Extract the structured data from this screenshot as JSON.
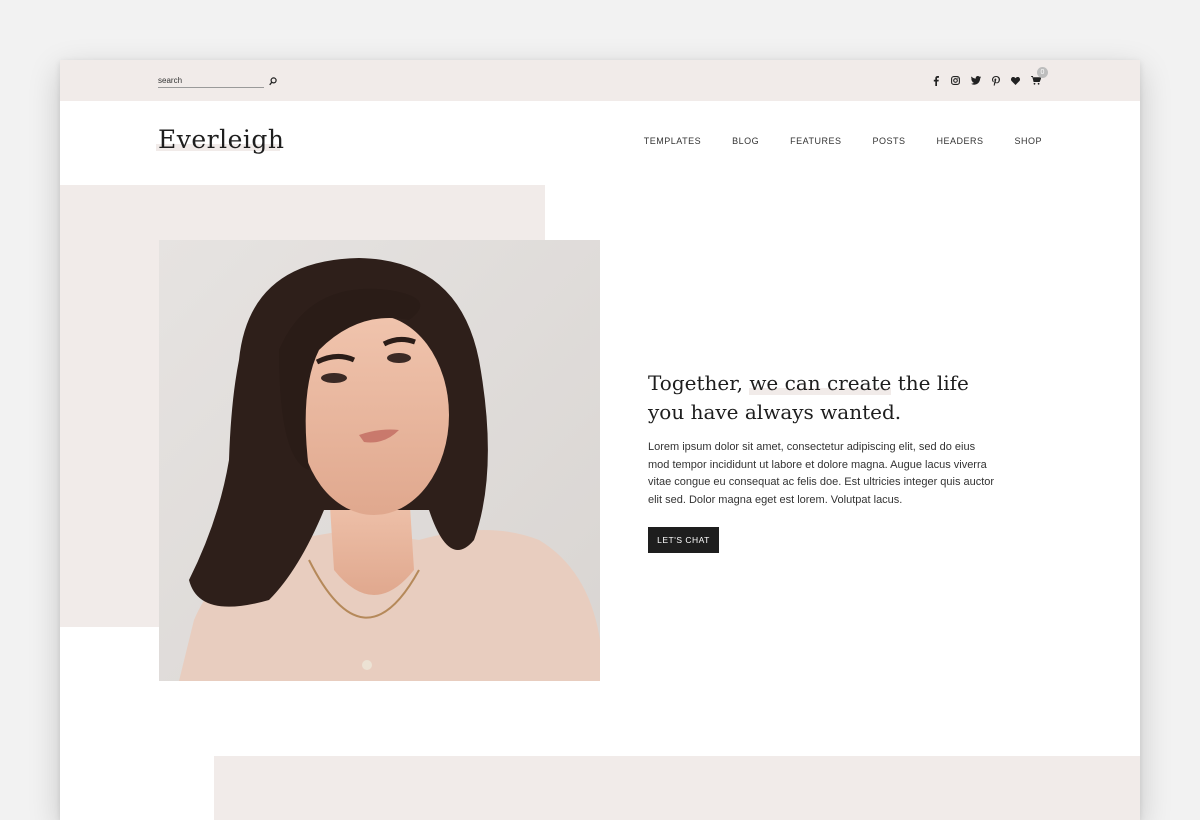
{
  "topbar": {
    "search": {
      "placeholder": "search"
    },
    "social_icons": [
      "facebook-icon",
      "instagram-icon",
      "twitter-icon",
      "pinterest-icon",
      "heart-icon",
      "cart-icon"
    ],
    "cart_count": "0"
  },
  "header": {
    "logo": "Everleigh",
    "nav": [
      "TEMPLATES",
      "BLOG",
      "FEATURES",
      "POSTS",
      "HEADERS",
      "SHOP"
    ]
  },
  "hero": {
    "headline_part1": "Together, ",
    "headline_highlight": "we can create",
    "headline_part2": " the life you have always wanted.",
    "body": "Lorem ipsum dolor sit amet, consectetur adipiscing elit, sed do eius mod tempor incididunt ut labore et dolore magna. Augue lacus viverra vitae congue eu consequat ac felis doe. Est ultricies integer quis auctor elit sed. Dolor magna eget est lorem. Volutpat lacus.",
    "cta_label": "LET'S CHAT"
  },
  "colors": {
    "accent_blush": "#f1ebe9",
    "dark": "#1e1e1e",
    "page_bg": "#f2f2f2"
  }
}
